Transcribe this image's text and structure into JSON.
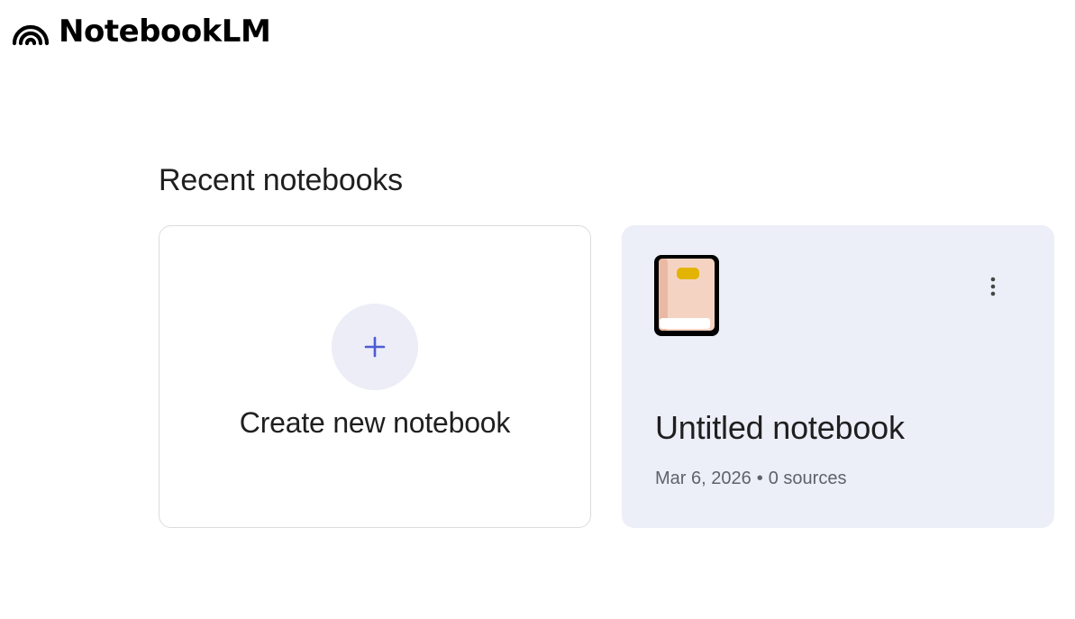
{
  "app": {
    "name": "NotebookLM",
    "logo_icon": "notebooklm-logo-icon"
  },
  "recent": {
    "title": "Recent notebooks"
  },
  "create_card": {
    "label": "Create new notebook",
    "icon": "plus-icon",
    "accent_color": "#4a5bd4"
  },
  "notebooks": [
    {
      "title": "Untitled notebook",
      "date": "Mar 6, 2026",
      "separator": "•",
      "sources": "0 sources",
      "icon": "book-emoji-icon",
      "menu_icon": "more-vert-icon"
    }
  ],
  "colors": {
    "card_bg": "#eceef8",
    "plus_circle_bg": "#ecedf6"
  }
}
